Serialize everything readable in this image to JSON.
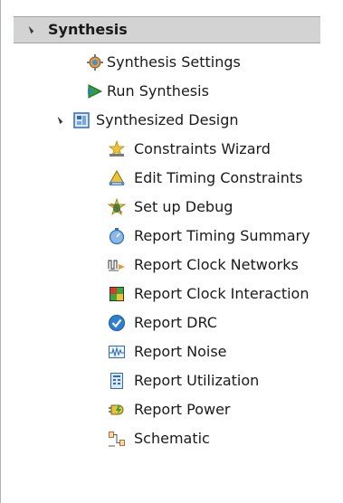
{
  "section": {
    "label": "Synthesis"
  },
  "items": [
    {
      "label": "Synthesis Settings",
      "icon": "gear-icon"
    },
    {
      "label": "Run Synthesis",
      "icon": "run-icon"
    },
    {
      "label": "Synthesized Design",
      "icon": "design-icon"
    }
  ],
  "sub_items": [
    {
      "label": "Constraints Wizard",
      "icon": "wizard-icon"
    },
    {
      "label": "Edit Timing Constraints",
      "icon": "timing-constraints-icon"
    },
    {
      "label": "Set up Debug",
      "icon": "debug-icon"
    },
    {
      "label": "Report Timing Summary",
      "icon": "stopwatch-icon"
    },
    {
      "label": "Report Clock Networks",
      "icon": "clock-network-icon"
    },
    {
      "label": "Report Clock Interaction",
      "icon": "clock-interaction-icon"
    },
    {
      "label": "Report DRC",
      "icon": "check-icon"
    },
    {
      "label": "Report Noise",
      "icon": "noise-icon"
    },
    {
      "label": "Report Utilization",
      "icon": "utilization-icon"
    },
    {
      "label": "Report Power",
      "icon": "power-icon"
    },
    {
      "label": "Schematic",
      "icon": "schematic-icon"
    }
  ],
  "colors": {
    "header_bg": "#d3d3d3",
    "accent_blue": "#2f7fd1"
  }
}
